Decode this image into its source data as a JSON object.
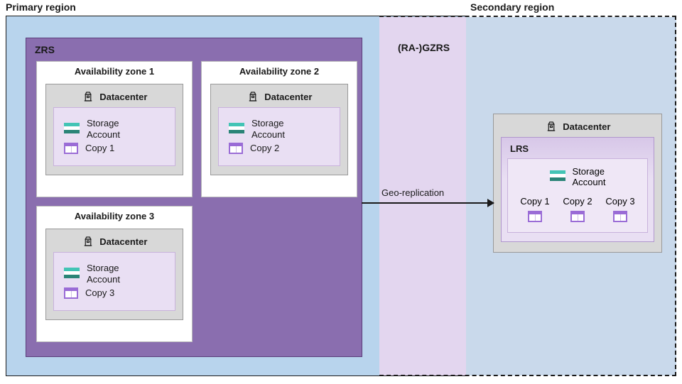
{
  "labels": {
    "primary_region": "Primary region",
    "secondary_region": "Secondary region",
    "zrs": "ZRS",
    "ra_gzrs": "(RA-)GZRS",
    "geo_replication": "Geo-replication",
    "datacenter": "Datacenter",
    "storage_account": "Storage\nAccount",
    "lrs": "LRS"
  },
  "primary": {
    "zones": [
      {
        "title": "Availability zone 1",
        "copy": "Copy 1"
      },
      {
        "title": "Availability zone 2",
        "copy": "Copy 2"
      },
      {
        "title": "Availability zone 3",
        "copy": "Copy 3"
      }
    ]
  },
  "secondary": {
    "copies": [
      "Copy 1",
      "Copy 2",
      "Copy 3"
    ]
  }
}
